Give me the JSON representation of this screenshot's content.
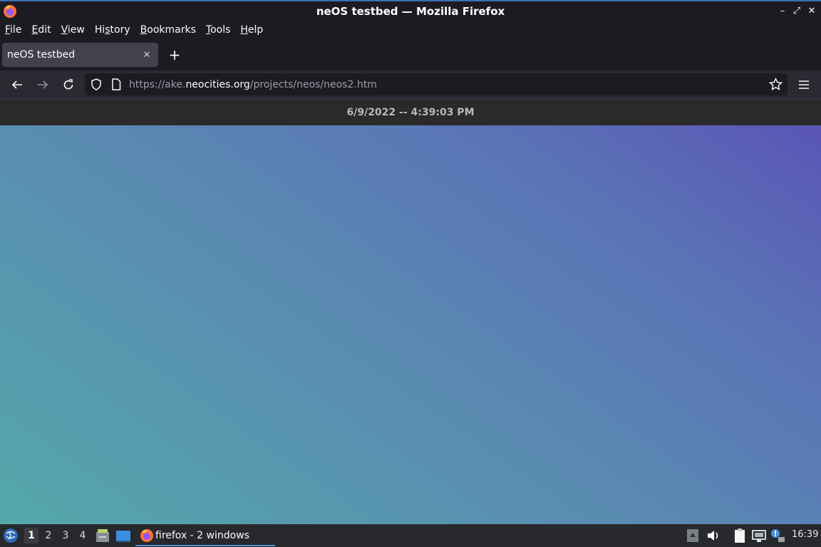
{
  "window": {
    "title": "neOS testbed — Mozilla Firefox"
  },
  "menu": [
    "File",
    "Edit",
    "View",
    "History",
    "Bookmarks",
    "Tools",
    "Help"
  ],
  "tab": {
    "title": "neOS testbed"
  },
  "url": {
    "prefix": "https://ake.",
    "domain": "neocities.org",
    "path": "/projects/neos/neos2.htm"
  },
  "page": {
    "datetime": "6/9/2022 -- 4:39:03 PM"
  },
  "taskbar": {
    "workspaces": [
      "1",
      "2",
      "3",
      "4"
    ],
    "active_workspace": "1",
    "task_label": "firefox - 2 windows",
    "clock": "16:39"
  },
  "colors": {
    "accent": "#4a90d9",
    "gradient_start": "#54a8ab",
    "gradient_end": "#5a55b6"
  },
  "icons": [
    "firefox-icon",
    "minimize-icon",
    "restore-icon",
    "close-icon",
    "back-icon",
    "forward-icon",
    "reload-icon",
    "shield-icon",
    "page-icon",
    "star-icon",
    "hamburger-menu-icon",
    "start-menu-icon",
    "file-manager-icon",
    "desktop-icon",
    "volume-icon",
    "clipboard-icon",
    "network-icon",
    "notification-icon"
  ]
}
